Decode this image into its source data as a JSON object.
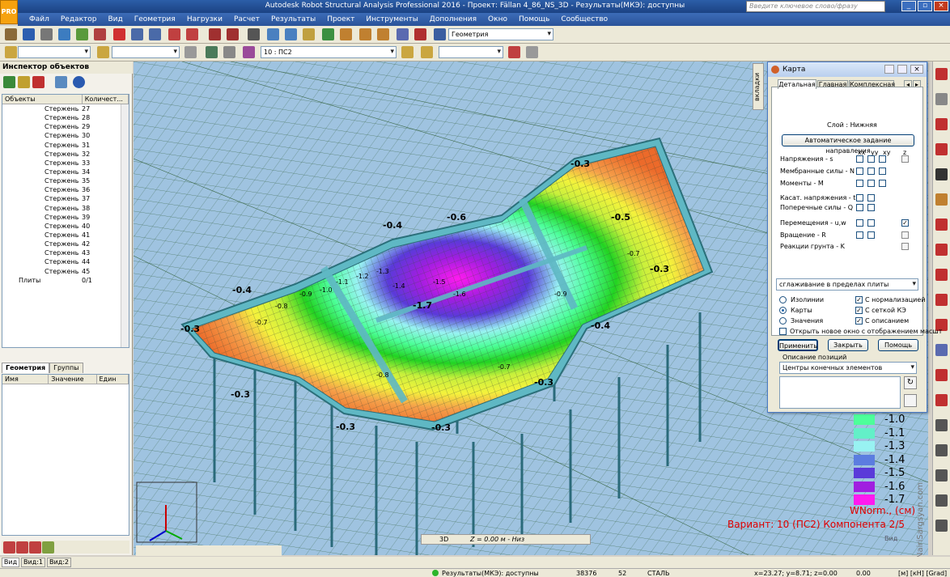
{
  "app": {
    "title": "Autodesk Robot Structural Analysis Professional 2016 - Проект: Fällan 4_86_NS_3D - Результаты(МКЭ): доступны",
    "logo_text": "PRO",
    "search_placeholder": "Введите ключевое слово/фразу",
    "window_controls": [
      "_",
      "▫",
      "×"
    ]
  },
  "menu": [
    "Файл",
    "Редактор",
    "Вид",
    "Геометрия",
    "Нагрузки",
    "Расчет",
    "Результаты",
    "Проект",
    "Инструменты",
    "Дополнения",
    "Окно",
    "Помощь",
    "Сообщество"
  ],
  "toolbar": {
    "layout_combo": "Геометрия",
    "case_combo": "10 : ПС2"
  },
  "inspector": {
    "title": "Инспектор объектов",
    "col_objects": "Объекты",
    "col_count": "Количест...",
    "rows": [
      {
        "name": "Стержень",
        "count": "27"
      },
      {
        "name": "Стержень",
        "count": "28"
      },
      {
        "name": "Стержень",
        "count": "29"
      },
      {
        "name": "Стержень",
        "count": "30"
      },
      {
        "name": "Стержень",
        "count": "31"
      },
      {
        "name": "Стержень",
        "count": "32"
      },
      {
        "name": "Стержень",
        "count": "33"
      },
      {
        "name": "Стержень",
        "count": "34"
      },
      {
        "name": "Стержень",
        "count": "35"
      },
      {
        "name": "Стержень",
        "count": "36"
      },
      {
        "name": "Стержень",
        "count": "37"
      },
      {
        "name": "Стержень",
        "count": "38"
      },
      {
        "name": "Стержень",
        "count": "39"
      },
      {
        "name": "Стержень",
        "count": "40"
      },
      {
        "name": "Стержень",
        "count": "41"
      },
      {
        "name": "Стержень",
        "count": "42"
      },
      {
        "name": "Стержень",
        "count": "43"
      },
      {
        "name": "Стержень",
        "count": "44"
      },
      {
        "name": "Стержень",
        "count": "45"
      }
    ],
    "plates_row": {
      "name": "Плиты",
      "count": "0/1"
    },
    "tab_geometry": "Геометрия",
    "tab_groups": "Группы",
    "prop_name": "Имя",
    "prop_value": "Значение",
    "prop_unit": "Един"
  },
  "karta": {
    "title": "Карта",
    "side_tab": "вкладки",
    "tabs": [
      "Детальная",
      "Главная",
      "Комплексная"
    ],
    "layer": "Слой : Нижняя",
    "auto_dir_button": "Автоматическое задание направления",
    "cols": [
      "xx",
      "yy",
      "xy",
      "z"
    ],
    "rows": [
      "Напряжения - s",
      "Мембранные силы - N",
      "Моменты - M",
      "Касат. напряжения - t",
      "Поперечные силы - Q",
      "Перемещения - u,w",
      "Вращение - R",
      "Реакции грунта - K"
    ],
    "smoothing": "сглаживание в пределах плиты",
    "opt_isolines": "Изолинии",
    "opt_maps": "Карты",
    "opt_values": "Значения",
    "opt_normalize": "С нормализацией",
    "opt_fe_mesh": "С сеткой КЭ",
    "opt_description": "С описанием",
    "open_new_window": "Открыть новое окно с отображением масшт",
    "btn_apply": "Применить",
    "btn_close": "Закрыть",
    "btn_help": "Помощь",
    "positions_label": "Описание позиций",
    "positions_combo": "Центры конечных элементов"
  },
  "legend": {
    "values": [
      "-1.0",
      "-1.1",
      "-1.3",
      "-1.4",
      "-1.5",
      "-1.6",
      "-1.7"
    ],
    "colors": [
      "#4dff9a",
      "#63f0c8",
      "#98f2f2",
      "#5b7de0",
      "#5a3ad9",
      "#a01ee0",
      "#ff1aef"
    ],
    "unit_label": "WNorm., (см)",
    "case_label": "Вариант: 10 (ПС2) Компонента 2/5",
    "watermark": "NairiSargsyan.com"
  },
  "contour_labels": [
    "-0.3",
    "-0.4",
    "-0.6",
    "-0.5",
    "-0.3",
    "-0.4",
    "-0.3",
    "-0.4",
    "-0.3",
    "-0.3",
    "-0.7",
    "-0.8",
    "-0.9",
    "-1.0",
    "-1.1",
    "-1.2",
    "-1.3",
    "-1.4",
    "-1.5",
    "-1.6",
    "-1.7"
  ],
  "viewport": {
    "view_mode": "3D",
    "level": "Z = 0.00 м - Низ",
    "tab_view": "Вид",
    "tab_view1": "Вид:1",
    "tab_view2": "Вид:2",
    "corner_label": "Вид"
  },
  "status": {
    "results": "Результаты(МКЭ): доступны",
    "nodes": "38376",
    "count": "52",
    "material": "СТАЛЬ",
    "coords": "x=23.27; y=8.71; z=0.00",
    "value": "0.00",
    "units": "[м] [кН] [Grad]"
  }
}
